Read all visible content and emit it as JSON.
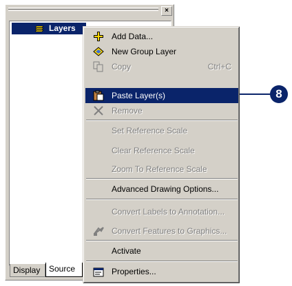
{
  "toc": {
    "close_label": "×",
    "tree_root": "Layers",
    "tabs": [
      "Display",
      "Source"
    ]
  },
  "context_menu": {
    "items": [
      {
        "label": "Add Data...",
        "icon": "add-data-icon",
        "enabled": true
      },
      {
        "label": "New Group Layer",
        "icon": "group-layer-icon",
        "enabled": true
      },
      {
        "label": "Copy",
        "shortcut": "Ctrl+C",
        "icon": "copy-icon",
        "enabled": false
      },
      {
        "label": "Paste Layer(s)",
        "icon": "paste-icon",
        "enabled": true,
        "highlighted": true
      },
      {
        "label": "Remove",
        "icon": "remove-icon",
        "enabled": false
      },
      {
        "label": "Set Reference Scale",
        "enabled": false
      },
      {
        "label": "Clear Reference Scale",
        "enabled": false
      },
      {
        "label": "Zoom To Reference Scale",
        "enabled": false
      },
      {
        "label": "Advanced Drawing Options...",
        "enabled": true
      },
      {
        "label": "Convert Labels to Annotation...",
        "enabled": false
      },
      {
        "label": "Convert Features to Graphics...",
        "icon": "convert-features-icon",
        "enabled": false
      },
      {
        "label": "Activate",
        "enabled": true
      },
      {
        "label": "Properties...",
        "icon": "properties-icon",
        "enabled": true
      }
    ]
  },
  "callout": {
    "number": "8"
  },
  "colors": {
    "highlight": "#0a246a",
    "face": "#d4d0c8",
    "add_data_green": "#00a000",
    "group_yellow": "#ffd800"
  }
}
